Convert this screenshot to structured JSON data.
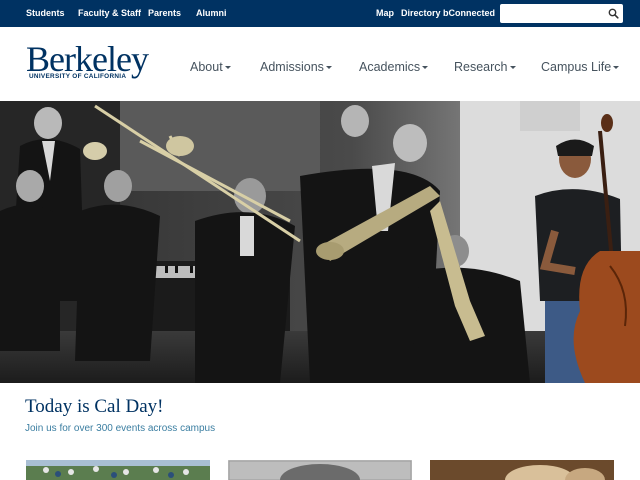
{
  "topbar": {
    "links": [
      "Students",
      "Faculty & Staff",
      "Parents",
      "Alumni"
    ],
    "right_links": [
      "Map",
      "Directory",
      "bConnected"
    ],
    "search_placeholder": ""
  },
  "brand": {
    "logo_word": "Berkeley",
    "logo_sub": "UNIVERSITY OF CALIFORNIA"
  },
  "nav": {
    "items": [
      "About",
      "Admissions",
      "Academics",
      "Research",
      "Campus Life"
    ]
  },
  "feature": {
    "title": "Today is Cal Day!",
    "subtitle": "Join us for over 300 events across campus"
  },
  "colors": {
    "berkeley_blue": "#003262",
    "link_blue": "#3b7ea1",
    "nav_text": "#46535e"
  },
  "icons": {
    "search": "search-icon",
    "caret": "caret-down-icon"
  }
}
